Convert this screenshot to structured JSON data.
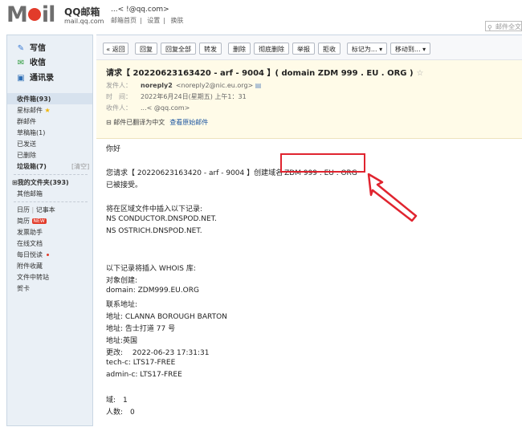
{
  "header": {
    "logo_text": "M",
    "logo_tail": "il",
    "brand": "QQ邮箱",
    "brand_sub": "mail.qq.com",
    "account": "...<             !@qq.com>",
    "links": [
      "邮箱首页",
      "|",
      "设置",
      "|",
      "换肤"
    ],
    "search_placeholder": "邮件全文"
  },
  "sidebar": {
    "compose": "写信",
    "receive": "收信",
    "contacts": "通讯录",
    "inbox": "收件箱(93)",
    "items": [
      "星标邮件",
      "群邮件",
      "草稿箱(1)",
      "已发送",
      "已删除"
    ],
    "spam": "垃圾箱(7)",
    "spam_clear": "[清空]",
    "folders": "我的文件夹(393)",
    "other": "其他邮箱",
    "tools": [
      "日历",
      "|",
      "记事本"
    ],
    "tool_items": [
      "简历",
      "发票助手",
      "在线文档",
      "每日悦读",
      "附件收藏",
      "文件中转站",
      "贺卡"
    ],
    "new_badge": "NEW"
  },
  "toolbar": {
    "back": "« 返回",
    "buttons": [
      "回复",
      "回复全部",
      "转发",
      "删除",
      "彻底删除",
      "举报",
      "拒收"
    ],
    "mark": "标记为...",
    "move": "移动到..."
  },
  "mail": {
    "subject": "请求【 20220623163420 - arf - 9004 】( domain ZDM 999 . EU . ORG )",
    "from_label": "发件人：",
    "from_name": "noreply2",
    "from_addr": "<noreply2@nic.eu.org>",
    "time_label": "时　间：",
    "time": "2022年6月24日(星期五) 上午1：31",
    "to_label": "收件人：",
    "to": "...<             @qq.com>",
    "translate_text": "邮件已翻译为中文",
    "view_original": "查看原始邮件"
  },
  "body": {
    "greeting": "你好",
    "line1a": "您请求【 20220623163420 - arf - 9004 】创建域名",
    "line1b": "ZDM 999 . EU . ORG",
    "line2": "已被接受。",
    "zone1": "将在区域文件中插入以下记录:",
    "ns1": "NS CONDUCTOR.DNSPOD.NET.",
    "ns2": "NS OSTRICH.DNSPOD.NET.",
    "whois_intro": "以下记录将插入 WHOIS 库:",
    "obj": "对象创建:",
    "domain": "domain: ZDM999.EU.ORG",
    "contact": "联系地址:",
    "addr1": "地址: CLANNA BOROUGH BARTON",
    "addr2": "地址: 告士打道 77 号",
    "addr3": "地址:英国",
    "changed": "更改:　 2022-06-23 17:31:31",
    "tech": "tech-c: LTS17-FREE",
    "admin": "admin-c: LTS17-FREE",
    "field": "域:　1",
    "count": "人数:　0"
  },
  "colors": {
    "highlight": "#e0242f",
    "link": "#1c55a0"
  }
}
